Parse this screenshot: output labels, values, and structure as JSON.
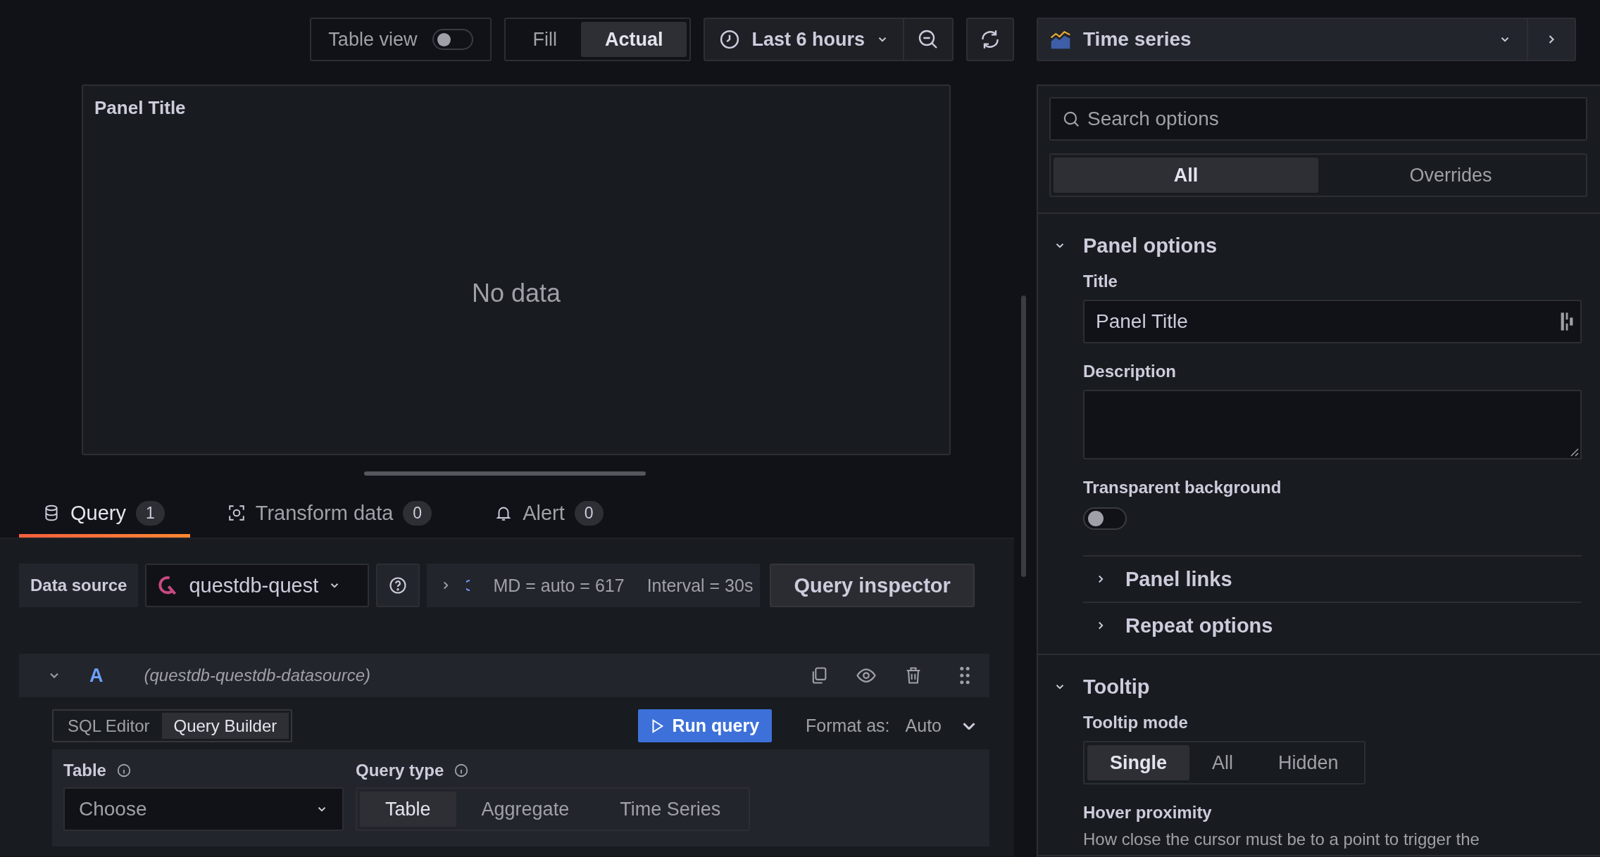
{
  "toolbar": {
    "table_view": {
      "label": "Table view",
      "on": false
    },
    "fit": [
      {
        "label": "Fill",
        "selected": false
      },
      {
        "label": "Actual",
        "selected": true
      }
    ],
    "time_range": "Last 6 hours"
  },
  "visualization": {
    "name": "Time series"
  },
  "panel": {
    "title": "Panel Title",
    "message": "No data"
  },
  "tabs": [
    {
      "label": "Query",
      "count": "1",
      "selected": true,
      "kind": "database"
    },
    {
      "label": "Transform data",
      "count": "0",
      "selected": false,
      "kind": "transform"
    },
    {
      "label": "Alert",
      "count": "0",
      "selected": false,
      "kind": "bell"
    }
  ],
  "data_source": {
    "label": "Data source",
    "value": "questdb-quest",
    "query_options": [
      "MD = auto = 617",
      "Interval = 30s"
    ],
    "inspector": "Query inspector"
  },
  "query": {
    "ref": "A",
    "datasource": "(questdb-questdb-datasource)",
    "expanded": true,
    "editor_modes": [
      {
        "label": "SQL Editor",
        "selected": false
      },
      {
        "label": "Query Builder",
        "selected": true
      }
    ],
    "run": "Run query",
    "format_label": "Format as:",
    "format_value": "Auto",
    "table": {
      "label": "Table",
      "placeholder": "Choose"
    },
    "query_type": {
      "label": "Query type",
      "options": [
        {
          "label": "Table",
          "selected": true
        },
        {
          "label": "Aggregate",
          "selected": false
        },
        {
          "label": "Time Series",
          "selected": false
        }
      ]
    }
  },
  "options": {
    "search_placeholder": "Search options",
    "tabs": [
      {
        "label": "All",
        "selected": true
      },
      {
        "label": "Overrides",
        "selected": false
      }
    ],
    "sections": [
      {
        "title": "Panel options",
        "expanded": true,
        "fields": [
          {
            "kind": "input",
            "label": "Title",
            "value": "Panel Title"
          },
          {
            "kind": "textarea",
            "label": "Description"
          },
          {
            "kind": "toggle",
            "label": "Transparent background",
            "on": false
          }
        ],
        "subsections": [
          {
            "title": "Panel links",
            "expanded": false
          },
          {
            "title": "Repeat options",
            "expanded": false
          }
        ]
      },
      {
        "title": "Tooltip",
        "expanded": true,
        "fields": [
          {
            "kind": "radio",
            "label": "Tooltip mode",
            "options": [
              {
                "label": "Single",
                "selected": true
              },
              {
                "label": "All",
                "selected": false
              },
              {
                "label": "Hidden",
                "selected": false
              }
            ]
          },
          {
            "kind": "text",
            "label": "Hover proximity",
            "description": "How close the cursor must be to a point to trigger the"
          }
        ]
      }
    ]
  }
}
